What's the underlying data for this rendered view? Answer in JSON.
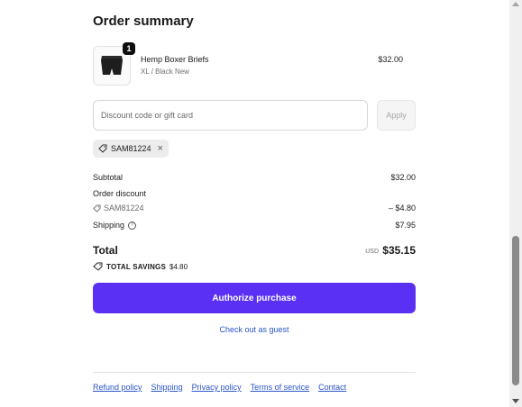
{
  "order_summary": {
    "title": "Order summary",
    "product": {
      "name": "Hemp Boxer Briefs",
      "variant": "XL / Black New",
      "price": "$32.00",
      "quantity": "1"
    },
    "discount": {
      "placeholder": "Discount code or gift card",
      "apply_label": "Apply",
      "applied_code": "SAM81224"
    },
    "lines": {
      "subtotal_label": "Subtotal",
      "subtotal_value": "$32.00",
      "order_discount_label": "Order discount",
      "discount_code": "SAM81224",
      "discount_value": "– $4.80",
      "shipping_label": "Shipping",
      "shipping_value": "$7.95"
    },
    "total": {
      "label": "Total",
      "currency": "USD",
      "value": "$35.15",
      "savings_label": "TOTAL SAVINGS",
      "savings_value": "$4.80"
    },
    "authorize_label": "Authorize purchase",
    "guest_label": "Check out as guest"
  },
  "footer": {
    "links": [
      "Refund policy",
      "Shipping",
      "Privacy policy",
      "Terms of service",
      "Contact"
    ]
  },
  "colors": {
    "primary": "#5a31f4",
    "link": "#2b55c9"
  },
  "icons": {
    "tag": "tag-icon",
    "remove": "close-icon",
    "help": "help-icon"
  }
}
